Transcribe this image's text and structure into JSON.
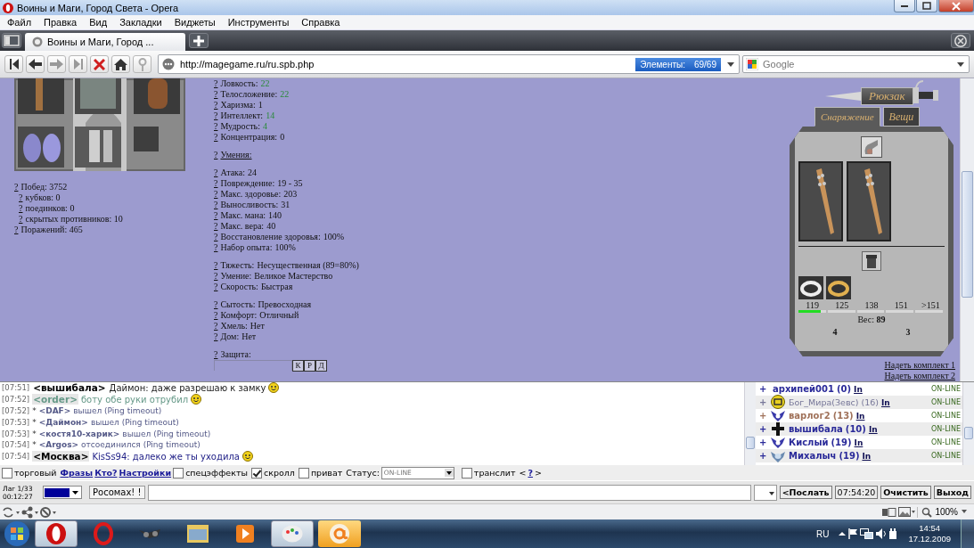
{
  "window": {
    "title": "Воины и Маги, Город Света - Opera"
  },
  "menu": [
    "Файл",
    "Правка",
    "Вид",
    "Закладки",
    "Виджеты",
    "Инструменты",
    "Справка"
  ],
  "tabs": [
    {
      "title": "Воины и Маги, Город ...",
      "selected": true
    }
  ],
  "address": {
    "url": "http://magegame.ru/ru.spb.php",
    "elements_label": "Элементы:",
    "elements_count": "69/69"
  },
  "search": {
    "placeholder": "Google"
  },
  "records": [
    {
      "help": "?",
      "label": "Побед: 3752",
      "children": [
        {
          "help": "?",
          "label": "кубков: 0"
        },
        {
          "help": "?",
          "label": "поединков: 0"
        },
        {
          "help": "?",
          "label": "скрытых противников: 10"
        }
      ]
    },
    {
      "help": "?",
      "label": "Поражений: 465"
    }
  ],
  "stat_groups": [
    {
      "lines": [
        {
          "kind": "stat",
          "help": "?",
          "label": "Ловкость:",
          "value": "22",
          "boosted": true
        },
        {
          "kind": "stat",
          "help": "?",
          "label": "Телосложение:",
          "value": "22",
          "boosted": true
        },
        {
          "kind": "stat",
          "help": "?",
          "label": "Харизма:",
          "value": "1",
          "boosted": false
        },
        {
          "kind": "stat",
          "help": "?",
          "label": "Интеллект:",
          "value": "14",
          "boosted": true
        },
        {
          "kind": "stat",
          "help": "?",
          "label": "Мудрость:",
          "value": "4",
          "boosted": true
        },
        {
          "kind": "stat",
          "help": "?",
          "label": "Концентрация:",
          "value": "0",
          "boosted": false
        }
      ]
    },
    {
      "lines": [
        {
          "kind": "heading",
          "help": "?",
          "label": "Умения:"
        }
      ]
    },
    {
      "lines": [
        {
          "kind": "stat",
          "help": "?",
          "label": "Атака:",
          "value": "24",
          "boosted": false
        },
        {
          "kind": "stat",
          "help": "?",
          "label": "Повреждение:",
          "value": "19 - 35",
          "boosted": false
        },
        {
          "kind": "stat",
          "help": "?",
          "label": "Макс. здоровье:",
          "value": "203",
          "boosted": false
        },
        {
          "kind": "stat",
          "help": "?",
          "label": "Выносливость:",
          "value": "31",
          "boosted": false
        },
        {
          "kind": "stat",
          "help": "?",
          "label": "Макс. мана:",
          "value": "140",
          "boosted": false
        },
        {
          "kind": "stat",
          "help": "?",
          "label": "Макс. вера:",
          "value": "40",
          "boosted": false
        },
        {
          "kind": "stat",
          "help": "?",
          "label": "Восстановление здоровья:",
          "value": "100%",
          "boosted": false
        },
        {
          "kind": "stat",
          "help": "?",
          "label": "Набор опыта:",
          "value": "100%",
          "boosted": false
        }
      ]
    },
    {
      "lines": [
        {
          "kind": "stat",
          "help": "?",
          "label": "Тяжесть:",
          "value": "Несущественная (89=80%)",
          "boosted": false
        },
        {
          "kind": "stat",
          "help": "?",
          "label": "Умение:",
          "value": "Великое Мастерство",
          "boosted": false
        },
        {
          "kind": "stat",
          "help": "?",
          "label": "Скорость:",
          "value": "Быстрая",
          "boosted": false
        }
      ]
    },
    {
      "lines": [
        {
          "kind": "stat",
          "help": "?",
          "label": "Сытость:",
          "value": "Превосходная",
          "boosted": false
        },
        {
          "kind": "stat",
          "help": "?",
          "label": "Комфорт:",
          "value": "Отличный",
          "boosted": false
        },
        {
          "kind": "stat",
          "help": "?",
          "label": "Хмель:",
          "value": "Нет",
          "boosted": false
        },
        {
          "kind": "stat",
          "help": "?",
          "label": "Дом:",
          "value": "Нет",
          "boosted": false
        }
      ]
    }
  ],
  "protection": {
    "help": "?",
    "label": "Защита:",
    "buttons": [
      "К",
      "Р",
      "Д"
    ]
  },
  "backpack": {
    "title": "Рюкзак",
    "tabs": [
      {
        "label": "Снаряжение",
        "selected": true
      },
      {
        "label": "Вещи",
        "selected": false
      }
    ],
    "weight_scale": [
      "119",
      "125",
      "138",
      "151",
      ">151"
    ],
    "level": 0.15,
    "weight": "Вес: **89**",
    "counts": [
      "4",
      "3"
    ]
  },
  "set_links": [
    "Надеть комплект 1",
    "Надеть комплект 2"
  ],
  "messages": [
    {
      "time": "[07:51]",
      "kind": "message",
      "nick": "<вышибала>",
      "text": "Даймон: даже разрешаю к замку",
      "color": "#222222",
      "highlighted": false,
      "emoticon": true
    },
    {
      "time": "[07:52]",
      "kind": "bot",
      "nick": "<order>",
      "text": "боту обе руки отрубил",
      "color": "#669988",
      "highlighted": true,
      "emoticon": true
    },
    {
      "time": "[07:52]",
      "kind": "system",
      "mark": "*",
      "nick": "<DAF>",
      "text": "вышел (Ping timeout)"
    },
    {
      "time": "[07:53]",
      "kind": "system",
      "mark": "*",
      "nick": "<Даймон>",
      "text": "вышел (Ping timeout)"
    },
    {
      "time": "[07:53]",
      "kind": "system",
      "mark": "*",
      "nick": "<костя10-харик>",
      "text": "вышел (Ping timeout)"
    },
    {
      "time": "[07:54]",
      "kind": "system",
      "mark": "*",
      "nick": "<Argos>",
      "text": "отсоединился (Ping timeout)"
    },
    {
      "time": "[07:54]",
      "kind": "message",
      "nick": "<Москва>",
      "text": "KisSs94: далеко же ты уходила",
      "color": "#222288",
      "highlighted": true,
      "emoticon": true
    }
  ],
  "users": [
    {
      "kind": "plain",
      "sign": "+",
      "name": "архипей001",
      "level": "(0)",
      "link": "In",
      "status": "ON-LINE",
      "color": "#2a2a99",
      "bold": true
    },
    {
      "kind": "clan",
      "sign": "+",
      "name": "Бог_Мира(Зевс)",
      "level": "(16)",
      "link": "In",
      "status": "ON-LINE",
      "color": "#777799",
      "bold": false
    },
    {
      "kind": "wings",
      "sign": "+",
      "name": "варлог2",
      "level": "(13)",
      "link": "In",
      "status": "ON-LINE",
      "color": "#a0725a",
      "bold": true
    },
    {
      "kind": "cross",
      "sign": "+",
      "name": "вышибала",
      "level": "(10)",
      "link": "In",
      "status": "ON-LINE",
      "color": "#2a2a99",
      "bold": true
    },
    {
      "kind": "wings",
      "sign": "+",
      "name": "Кислый",
      "level": "(19)",
      "link": "In",
      "status": "ON-LINE",
      "color": "#2a2a99",
      "bold": true
    },
    {
      "kind": "helm",
      "sign": "+",
      "name": "Михалыч",
      "level": "(19)",
      "link": "In",
      "status": "ON-LINE",
      "color": "#2a2a99",
      "bold": true
    }
  ],
  "options": [
    {
      "kind": "checkbox",
      "label": "торговый",
      "checked": false
    },
    {
      "kind": "link",
      "label": "Фразы"
    },
    {
      "kind": "link",
      "label": "Кто?"
    },
    {
      "kind": "link",
      "label": "Настройки"
    },
    {
      "kind": "checkbox",
      "label": "спецэффекты",
      "checked": false
    },
    {
      "kind": "checkbox",
      "label": "скролл",
      "checked": true
    },
    {
      "kind": "checkbox",
      "label": "приват",
      "checked": false
    },
    {
      "kind": "select",
      "label": "Статус:",
      "value": "ON-LINE"
    },
    {
      "kind": "checkbox",
      "label": "транслит",
      "checked": false
    },
    {
      "kind": "help",
      "before": "<",
      "link": "?",
      "after": ">"
    }
  ],
  "input_row": {
    "lag": "Лаг 1/33",
    "uptime": "00:12:27",
    "color": "#000099",
    "recipient": "Росомах! !",
    "send": "<Послать",
    "clock": "07:54:20",
    "clear": "Очистить",
    "exit": "Выход"
  },
  "status_bar": {
    "zoom": "100%"
  },
  "taskbar": {
    "apps": [
      {
        "kind": "opera",
        "open": true,
        "highlighted": false
      },
      {
        "kind": "opera-red",
        "open": false,
        "highlighted": false
      },
      {
        "kind": "goggles",
        "open": false,
        "highlighted": false
      },
      {
        "kind": "folder",
        "open": false,
        "highlighted": false
      },
      {
        "kind": "player",
        "open": false,
        "highlighted": false
      },
      {
        "kind": "paint",
        "open": true,
        "highlighted": false
      },
      {
        "kind": "mail",
        "open": false,
        "highlighted": true
      }
    ],
    "language": "RU",
    "time": "14:54",
    "date": "17.12.2009"
  }
}
